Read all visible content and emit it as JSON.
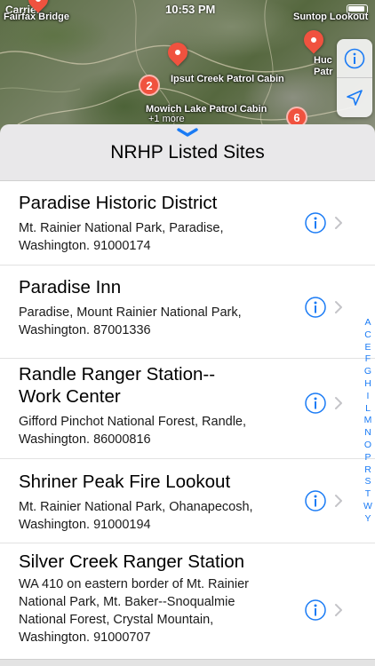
{
  "status_bar": {
    "carrier": "Carrier",
    "time": "10:53 PM"
  },
  "map": {
    "labels": {
      "fairfax": "Fairfax Bridge",
      "suntop": "Suntop Lookout",
      "ipsut": "Ipsut Creek Patrol Cabin",
      "mowich": "Mowich Lake Patrol Cabin",
      "mowich_more": "+1 more",
      "huck_1": "Huc",
      "huck_2": "Patr"
    },
    "clusters": {
      "cluster_a": "2",
      "cluster_b": "6"
    },
    "pin_color": "#f0523f",
    "controls": {
      "info_icon": "info-icon",
      "locate_icon": "location-arrow-icon"
    }
  },
  "sheet": {
    "title": "NRHP Listed Sites",
    "handle_icon": "chevron-down-icon"
  },
  "sites": [
    {
      "name": "Paradise Historic District",
      "lines": [
        "Mt. Rainier National Park, Paradise,",
        "Washington. 91000174"
      ]
    },
    {
      "name": "Paradise Inn",
      "lines": [
        "Paradise, Mount Rainier National Park,",
        "Washington. 87001336"
      ]
    },
    {
      "name": "Randle Ranger Station--",
      "name_line2": "Work Center",
      "lines": [
        "Gifford Pinchot National Forest, Randle,",
        "Washington. 86000816"
      ]
    },
    {
      "name": "Shriner Peak Fire Lookout",
      "lines": [
        "Mt. Rainier National Park, Ohanapecosh,",
        "Washington. 91000194"
      ]
    },
    {
      "name": "Silver Creek Ranger Station",
      "lines": [
        "WA 410 on eastern border of Mt. Rainier",
        "National Park, Mt. Baker--Snoqualmie",
        "National Forest, Crystal Mountain,",
        "Washington. 91000707"
      ]
    }
  ],
  "section_index": [
    "A",
    "C",
    "E",
    "F",
    "G",
    "H",
    "I",
    "L",
    "M",
    "N",
    "O",
    "P",
    "R",
    "S",
    "T",
    "W",
    "Y"
  ],
  "colors": {
    "accent": "#1a7bf5",
    "chevron": "#c4c4c8",
    "sheet_bg": "#e9e8ea"
  }
}
